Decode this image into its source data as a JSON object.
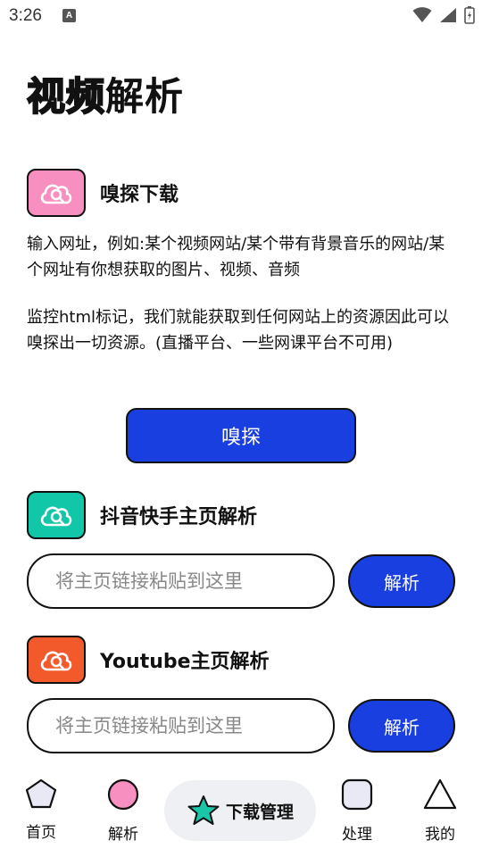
{
  "status_bar": {
    "time": "3:26",
    "notification_icon": "A"
  },
  "page": {
    "title_outline": "视频",
    "title_solid": "解析"
  },
  "sniff": {
    "title": "嗅探下载",
    "icon": "cloud-search-icon",
    "icon_bg": "#f78fc0",
    "desc1": "输入网址，例如:某个视频网站/某个带有背景音乐的网站/某个网址有你想获取的图片、视频、音频",
    "desc2": "监控html标记，我们就能获取到任何网站上的资源因此可以嗅探出一切资源。(直播平台、一些网课平台不可用)",
    "button": "嗅探"
  },
  "douyin": {
    "title": "抖音快手主页解析",
    "icon": "cloud-search-icon",
    "icon_bg": "#12c7a8",
    "placeholder": "将主页链接粘贴到这里",
    "value": "",
    "button": "解析"
  },
  "youtube": {
    "title": "Youtube主页解析",
    "icon": "cloud-search-icon",
    "icon_bg": "#f25a2c",
    "placeholder": "将主页链接粘贴到这里",
    "value": "",
    "button": "解析"
  },
  "nav": {
    "home": "首页",
    "parse": "解析",
    "download": "下载管理",
    "process": "处理",
    "mine": "我的"
  },
  "colors": {
    "accent": "#1a3fe0",
    "nav_parse": "#f78fc0",
    "nav_download": "#19c7a8",
    "nav_process": "#e8e9f5"
  }
}
